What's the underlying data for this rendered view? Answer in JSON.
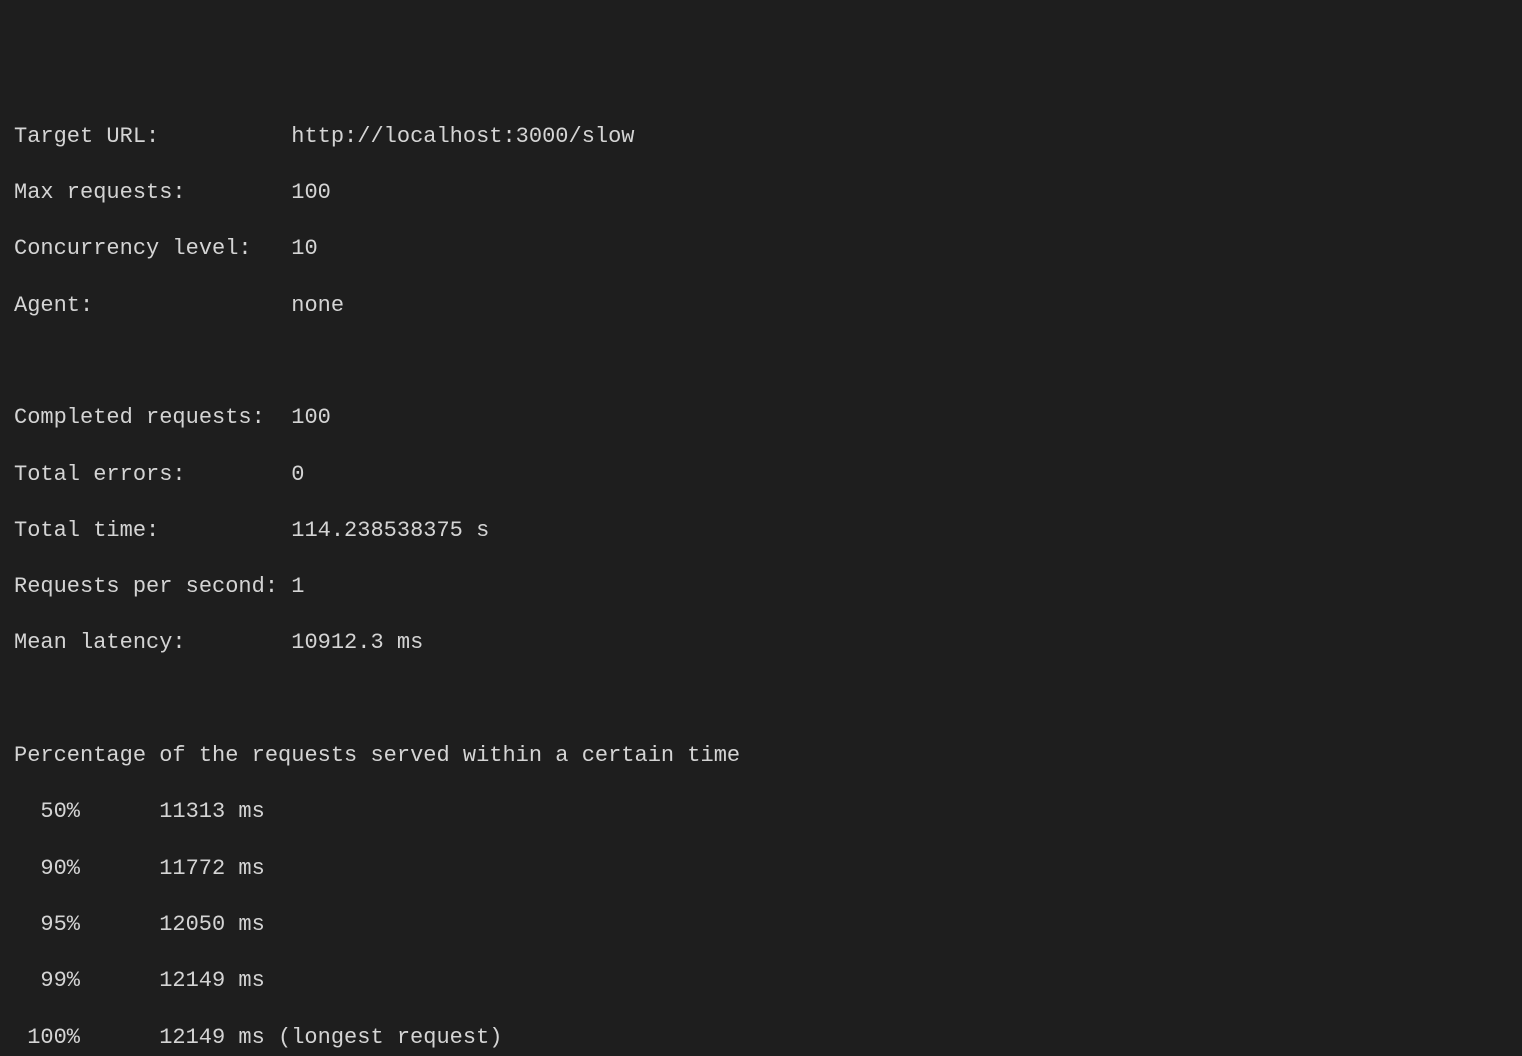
{
  "params": [
    {
      "label": "Target URL:         ",
      "value": "http://localhost:3000/slow"
    },
    {
      "label": "Max requests:       ",
      "value": "100"
    },
    {
      "label": "Concurrency level:  ",
      "value": "10"
    },
    {
      "label": "Agent:              ",
      "value": "none"
    }
  ],
  "summary": [
    {
      "label": "Completed requests: ",
      "value": "100"
    },
    {
      "label": "Total errors:       ",
      "value": "0"
    },
    {
      "label": "Total time:         ",
      "value": "114.238538375 s"
    },
    {
      "label": "Requests per second:",
      "value": "1"
    },
    {
      "label": "Mean latency:       ",
      "value": "10912.3 ms"
    }
  ],
  "percentile_heading": "Percentage of the requests served within a certain time",
  "percentiles": [
    {
      "pct": "50%",
      "time": "11313",
      "unit": " ms",
      "note": ""
    },
    {
      "pct": "90%",
      "time": "11772",
      "unit": " ms",
      "note": ""
    },
    {
      "pct": "95%",
      "time": "12050",
      "unit": " ms",
      "note": ""
    },
    {
      "pct": "99%",
      "time": "12149",
      "unit": " ms",
      "note": ""
    },
    {
      "pct": "100%",
      "time": "12149",
      "unit": " ms",
      "note": " (longest request)"
    }
  ]
}
